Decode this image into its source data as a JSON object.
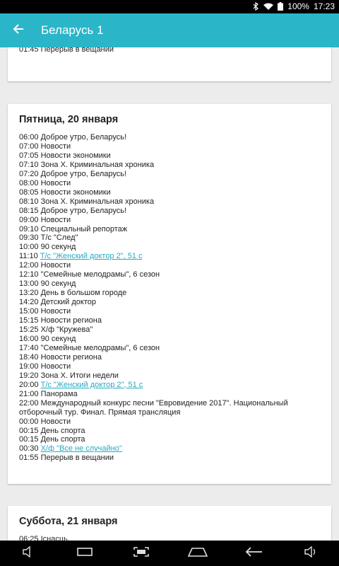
{
  "status": {
    "battery": "100%",
    "time": "17:23"
  },
  "header": {
    "title": "Беларусь 1"
  },
  "prev_card": {
    "lines": [
      {
        "time": "01:45",
        "title": "Перерыв в вещании",
        "link": false
      }
    ]
  },
  "friday": {
    "title": "Пятница, 20 января",
    "lines": [
      {
        "time": "06:00",
        "title": "Доброе утро, Беларусь!",
        "link": false
      },
      {
        "time": "07:00",
        "title": "Новости",
        "link": false
      },
      {
        "time": "07:05",
        "title": "Новости экономики",
        "link": false
      },
      {
        "time": "07:10",
        "title": "Зона Х. Криминальная хроника",
        "link": false
      },
      {
        "time": "07:20",
        "title": "Доброе утро, Беларусь!",
        "link": false
      },
      {
        "time": "08:00",
        "title": "Новости",
        "link": false
      },
      {
        "time": "08:05",
        "title": "Новости экономики",
        "link": false
      },
      {
        "time": "08:10",
        "title": "Зона Х. Криминальная хроника",
        "link": false
      },
      {
        "time": "08:15",
        "title": "Доброе утро, Беларусь!",
        "link": false
      },
      {
        "time": "09:00",
        "title": "Новости",
        "link": false
      },
      {
        "time": "09:10",
        "title": "Специальный репортаж",
        "link": false
      },
      {
        "time": "09:30",
        "title": "Т/с \"След\"",
        "link": false
      },
      {
        "time": "10:00",
        "title": "90 секунд",
        "link": false
      },
      {
        "time": "11:10",
        "title": "Т/с \"Женский доктор 2\", 51 с",
        "link": true
      },
      {
        "time": "12:00",
        "title": "Новости",
        "link": false
      },
      {
        "time": "12:10",
        "title": "\"Семейные мелодрамы\", 6 сезон",
        "link": false
      },
      {
        "time": "13:00",
        "title": "90 секунд",
        "link": false
      },
      {
        "time": "13:20",
        "title": "День в большом городе",
        "link": false
      },
      {
        "time": "14:20",
        "title": "Детский доктор",
        "link": false
      },
      {
        "time": "15:00",
        "title": "Новости",
        "link": false
      },
      {
        "time": "15:15",
        "title": "Новости региона",
        "link": false
      },
      {
        "time": "15:25",
        "title": "Х/ф \"Кружева\"",
        "link": false
      },
      {
        "time": "16:00",
        "title": "90 секунд",
        "link": false
      },
      {
        "time": "17:40",
        "title": "\"Семейные мелодрамы\", 6 сезон",
        "link": false
      },
      {
        "time": "18:40",
        "title": "Новости региона",
        "link": false
      },
      {
        "time": "19:00",
        "title": "Новости",
        "link": false
      },
      {
        "time": "19:20",
        "title": "Зона Х. Итоги недели",
        "link": false
      },
      {
        "time": "20:00",
        "title": "Т/с \"Женский доктор 2\", 51 с",
        "link": true
      },
      {
        "time": "21:00",
        "title": "Панорама",
        "link": false
      },
      {
        "time": "22:00",
        "title": "Международный конкурс песни \"Евровидение 2017\". Национальный отборочный тур. Финал. Прямая трансляция",
        "link": false
      },
      {
        "time": "00:00",
        "title": "Новости",
        "link": false
      },
      {
        "time": "00:15",
        "title": "День спорта",
        "link": false
      },
      {
        "time": "00:15",
        "title": "День спорта",
        "link": false
      },
      {
        "time": "00:30",
        "title": "Х/ф \"Все не случайно\"",
        "link": true
      },
      {
        "time": "01:55",
        "title": "Перерыв в вещании",
        "link": false
      }
    ]
  },
  "saturday": {
    "title": "Суббота, 21 января",
    "lines": [
      {
        "time": "06:25",
        "title": "Існасць",
        "link": false
      }
    ]
  }
}
